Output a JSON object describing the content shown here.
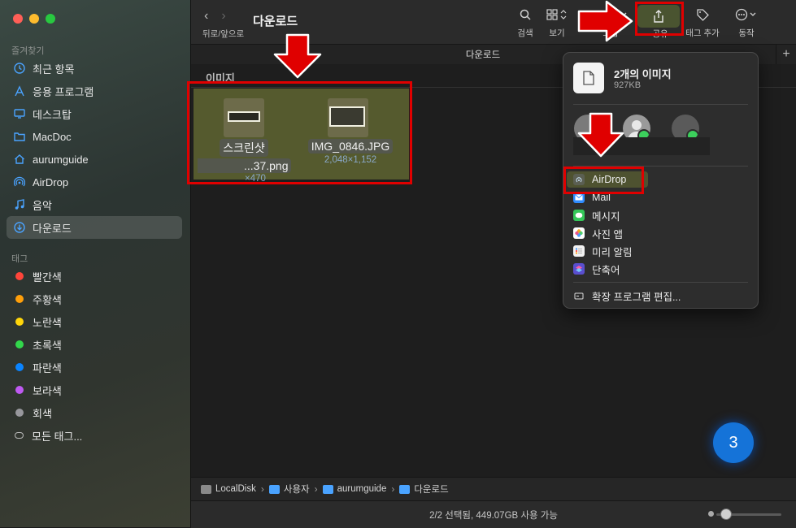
{
  "window": {
    "title": "다운로드",
    "nav_label": "뒤로/앞으로"
  },
  "sidebar": {
    "favorites_title": "즐겨찾기",
    "favorites": [
      {
        "label": "최근 항목",
        "icon": "clock-icon"
      },
      {
        "label": "응용 프로그램",
        "icon": "apps-icon"
      },
      {
        "label": "데스크탑",
        "icon": "desktop-icon"
      },
      {
        "label": "MacDoc",
        "icon": "folder-icon"
      },
      {
        "label": "aurumguide",
        "icon": "home-icon"
      },
      {
        "label": "AirDrop",
        "icon": "airdrop-icon"
      },
      {
        "label": "음악",
        "icon": "music-icon"
      },
      {
        "label": "다운로드",
        "icon": "download-icon",
        "selected": true
      }
    ],
    "tags_title": "태그",
    "tags": [
      {
        "label": "빨간색",
        "color": "#ff453a"
      },
      {
        "label": "주황색",
        "color": "#ff9f0a"
      },
      {
        "label": "노란색",
        "color": "#ffd60a"
      },
      {
        "label": "초록색",
        "color": "#32d74b"
      },
      {
        "label": "파란색",
        "color": "#0a84ff"
      },
      {
        "label": "보라색",
        "color": "#bf5af2"
      },
      {
        "label": "회색",
        "color": "#98989d"
      },
      {
        "label": "모든 태그...",
        "color": ""
      }
    ]
  },
  "toolbar": {
    "search_label": "검색",
    "view_label": "보기",
    "group_label": "그룹",
    "share_label": "공유",
    "tag_label": "태그 추가",
    "action_label": "동작"
  },
  "tab": {
    "title": "다운로드"
  },
  "content": {
    "group_title": "이미지",
    "files": [
      {
        "name_line1": "스크린샷",
        "name_line2": "...37.png",
        "meta": "×470"
      },
      {
        "name_line1": "IMG_0846.JPG",
        "meta": "2,048×1,152"
      }
    ]
  },
  "pathbar": {
    "items": [
      "LocalDisk",
      "사용자",
      "aurumguide",
      "다운로드"
    ]
  },
  "status": {
    "text": "2/2 선택됨, 449.07GB 사용 가능",
    "zoom_level": 0.15
  },
  "share_popover": {
    "title": "2개의 이미지",
    "size": "927KB",
    "items": [
      {
        "label": "AirDrop",
        "icon": "airdrop-icon",
        "color": "#5b5f52"
      },
      {
        "label": "Mail",
        "icon": "mail-icon",
        "color": "#2f8cff"
      },
      {
        "label": "메시지",
        "icon": "messages-icon",
        "color": "#34c759"
      },
      {
        "label": "사진 앱",
        "icon": "photos-icon",
        "color": "#f5a623"
      },
      {
        "label": "미리 알림",
        "icon": "reminders-icon",
        "color": "#f2f2f2"
      },
      {
        "label": "단축어",
        "icon": "shortcuts-icon",
        "color": "#5a4fcf"
      }
    ],
    "edit_extensions": "확장 프로그램 편집..."
  },
  "annotation": {
    "step_number": "3",
    "highlight_color": "#e00000"
  }
}
